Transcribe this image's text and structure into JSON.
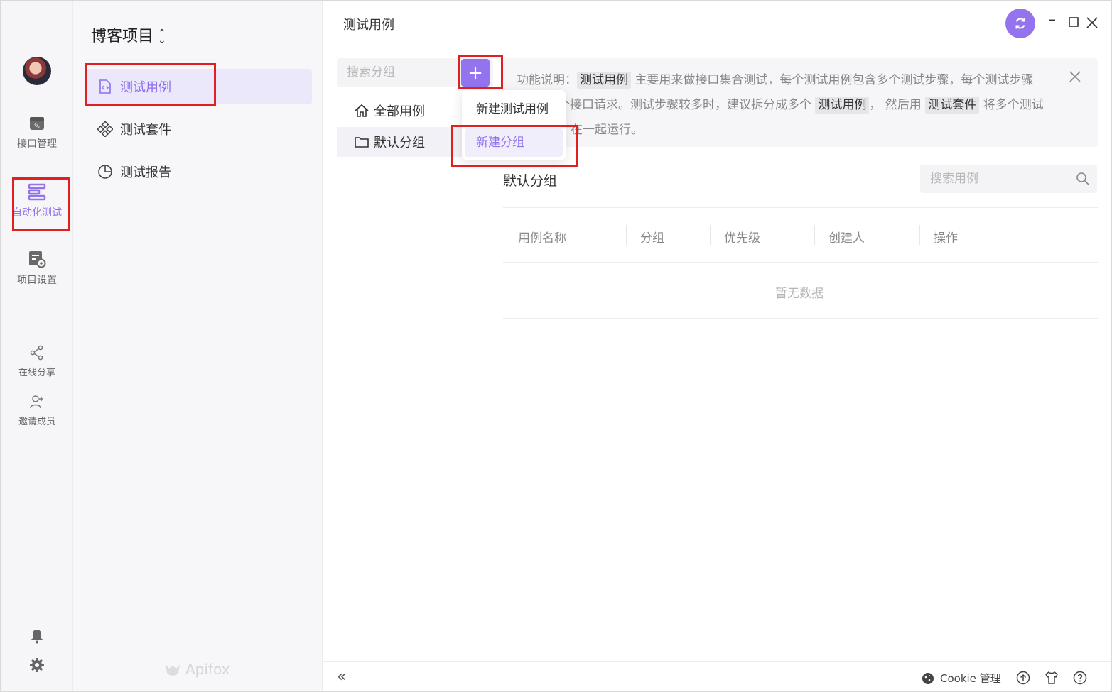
{
  "rail": {
    "items": [
      {
        "label": "接口管理",
        "icon": "api-management-icon",
        "active": false
      },
      {
        "label": "自动化测试",
        "icon": "automation-test-icon",
        "active": true
      },
      {
        "label": "项目设置",
        "icon": "project-settings-icon",
        "active": false
      },
      {
        "label": "在线分享",
        "icon": "share-icon",
        "active": false
      },
      {
        "label": "邀请成员",
        "icon": "invite-member-icon",
        "active": false
      }
    ]
  },
  "sidebar": {
    "project_title": "博客项目",
    "items": [
      {
        "label": "测试用例",
        "icon": "test-case-icon",
        "active": true
      },
      {
        "label": "测试套件",
        "icon": "test-suite-icon",
        "active": false
      },
      {
        "label": "测试报告",
        "icon": "test-report-icon",
        "active": false
      }
    ],
    "brand": "Apifox"
  },
  "main": {
    "title": "测试用例",
    "group_search_placeholder": "搜索分组",
    "groups": [
      {
        "label": "全部用例",
        "icon": "home-icon"
      },
      {
        "label": "默认分组",
        "icon": "folder-icon"
      }
    ],
    "dropdown": [
      "新建测试用例",
      "新建分组"
    ],
    "info": {
      "prefix": "功能说明：",
      "tag1": "测试用例",
      "text1": " 主要用来做接口集合测试，每个测试用例包含多个测试步骤，每个测试步骤",
      "text2": "个接口请求。测试步骤较多时，建议拆分成多个 ",
      "tag2": "测试用例",
      "text3": "， 然后用 ",
      "tag3": "测试套件",
      "text4": " 将多个测试",
      "text5": "在一起运行。"
    },
    "section_title": "默认分组",
    "case_search_placeholder": "搜索用例",
    "table": {
      "columns": [
        "用例名称",
        "分组",
        "优先级",
        "创建人",
        "操作"
      ],
      "empty_text": "暂无数据"
    }
  },
  "bottom": {
    "cookie_label": "Cookie 管理"
  },
  "colors": {
    "accent": "#9373ee",
    "highlight": "#e02020"
  }
}
